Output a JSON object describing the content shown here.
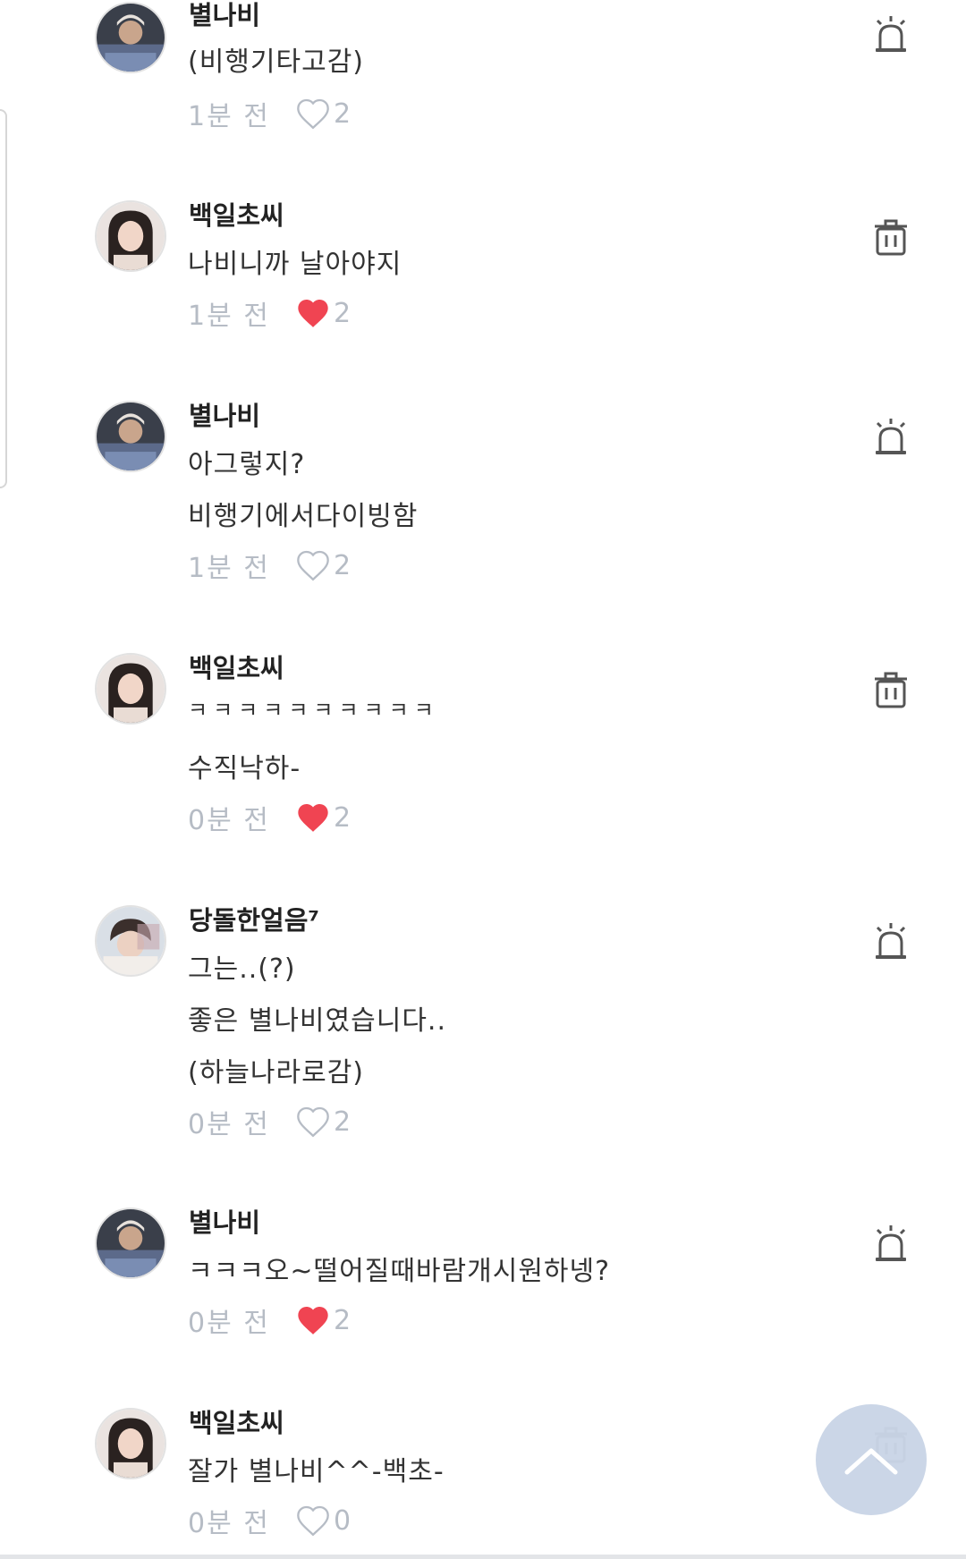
{
  "colors": {
    "text": "#333333",
    "username": "#222222",
    "muted": "#b6bcc5",
    "heart_liked": "#f04452",
    "heart_outline": "#b6bcc5",
    "icon": "#555555",
    "scroll_button": "#c5d1e4"
  },
  "comments": [
    {
      "username": "별나비",
      "avatar": "avatar-byeolnabi",
      "lines": [
        "(비행기타고감)"
      ],
      "time": "1분 전",
      "likes": "2",
      "liked": false,
      "action_icon": "report-icon"
    },
    {
      "username": "백일초씨",
      "avatar": "avatar-baekilcho",
      "lines": [
        "나비니까 날아야지"
      ],
      "time": "1분 전",
      "likes": "2",
      "liked": true,
      "action_icon": "trash-icon"
    },
    {
      "username": "별나비",
      "avatar": "avatar-byeolnabi",
      "lines": [
        "아그렇지?",
        "비행기에서다이빙함"
      ],
      "time": "1분 전",
      "likes": "2",
      "liked": false,
      "action_icon": "report-icon"
    },
    {
      "username": "백일초씨",
      "avatar": "avatar-baekilcho",
      "lines": [
        "ㅋㅋㅋㅋㅋㅋㅋㅋㅋㅋ",
        "수직낙하-"
      ],
      "time": "0분 전",
      "likes": "2",
      "liked": true,
      "action_icon": "trash-icon"
    },
    {
      "username": "당돌한얼음⁷",
      "avatar": "avatar-dangdol",
      "lines": [
        "그는..(?)",
        "좋은 별나비였습니다..",
        "(하늘나라로감)"
      ],
      "time": "0분 전",
      "likes": "2",
      "liked": false,
      "action_icon": "report-icon"
    },
    {
      "username": "별나비",
      "avatar": "avatar-byeolnabi",
      "lines": [
        "ㅋㅋㅋ오~떨어질때바람개시원하넹?"
      ],
      "time": "0분 전",
      "likes": "2",
      "liked": true,
      "action_icon": "report-icon"
    },
    {
      "username": "백일초씨",
      "avatar": "avatar-baekilcho",
      "lines": [
        "잘가 별나비^^-백초-"
      ],
      "time": "0분 전",
      "likes": "0",
      "liked": false,
      "action_icon": "trash-icon"
    }
  ],
  "scroll_top_icon": "chevron-up-icon"
}
